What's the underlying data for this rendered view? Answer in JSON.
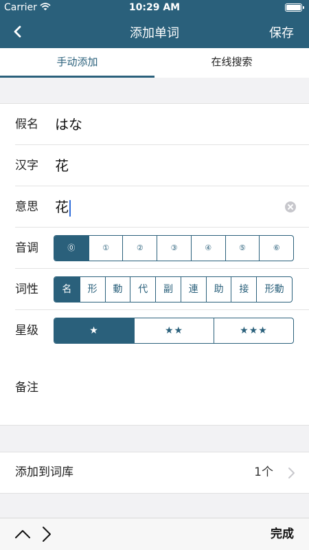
{
  "status_bar": {
    "carrier": "Carrier",
    "time": "10:29 AM"
  },
  "nav": {
    "title": "添加单词",
    "save_label": "保存"
  },
  "tabs": [
    {
      "label": "手动添加",
      "active": true
    },
    {
      "label": "在线搜索",
      "active": false
    }
  ],
  "form": {
    "kana": {
      "label": "假名",
      "value": "はな"
    },
    "kanji": {
      "label": "汉字",
      "value": "花"
    },
    "meaning": {
      "label": "意思",
      "value": "花"
    },
    "tone": {
      "label": "音调",
      "options": [
        "⓪",
        "①",
        "②",
        "③",
        "④",
        "⑤",
        "⑥"
      ],
      "selected": 0
    },
    "pos": {
      "label": "词性",
      "options": [
        "名",
        "形",
        "動",
        "代",
        "副",
        "連",
        "助",
        "接",
        "形動"
      ],
      "selected": 0
    },
    "stars": {
      "label": "星级",
      "options": [
        "★",
        "★★",
        "★★★"
      ],
      "selected": 0
    },
    "note": {
      "label": "备注"
    }
  },
  "library": {
    "label": "添加到词库",
    "count": "1个"
  },
  "toolbar": {
    "done_label": "完成"
  },
  "colors": {
    "accent": "#2a607b",
    "cursor": "#2f6cd9"
  },
  "icons": [
    "wifi-icon",
    "battery-icon",
    "back-chevron-icon",
    "clear-icon",
    "chevron-right-icon",
    "chevron-up-icon",
    "chevron-down-icon"
  ]
}
